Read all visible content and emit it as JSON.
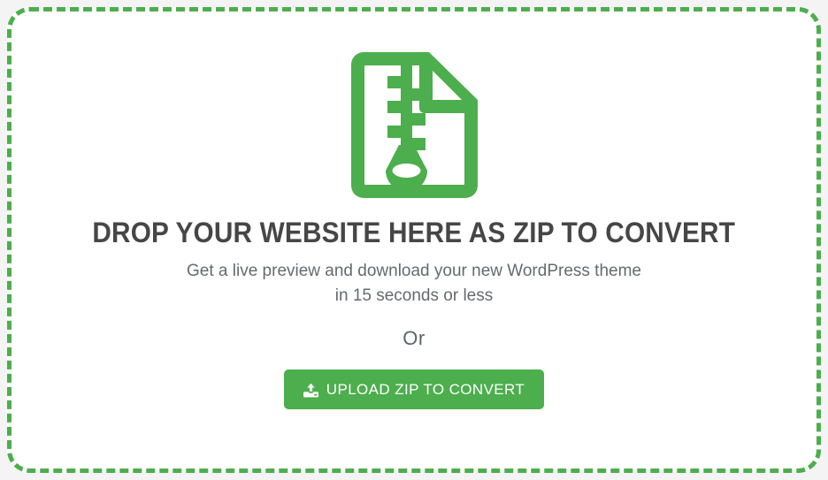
{
  "dropzone": {
    "icon_name": "zip-file-icon",
    "headline": "DROP YOUR WEBSITE HERE AS ZIP TO CONVERT",
    "subtitle_line_1": "Get a live preview and download your new WordPress theme",
    "subtitle_line_2": "in 15 seconds or less",
    "or_label": "Or",
    "upload_button": {
      "label": "UPLOAD ZIP TO CONVERT",
      "icon_name": "upload-icon"
    }
  },
  "colors": {
    "accent_green": "#4cae4c",
    "page_background": "#f4f4f4",
    "dropzone_background": "#ffffff",
    "headline_text": "#464646",
    "subtitle_text": "#666a6e",
    "or_text": "#5e6366",
    "button_text": "#ffffff"
  }
}
